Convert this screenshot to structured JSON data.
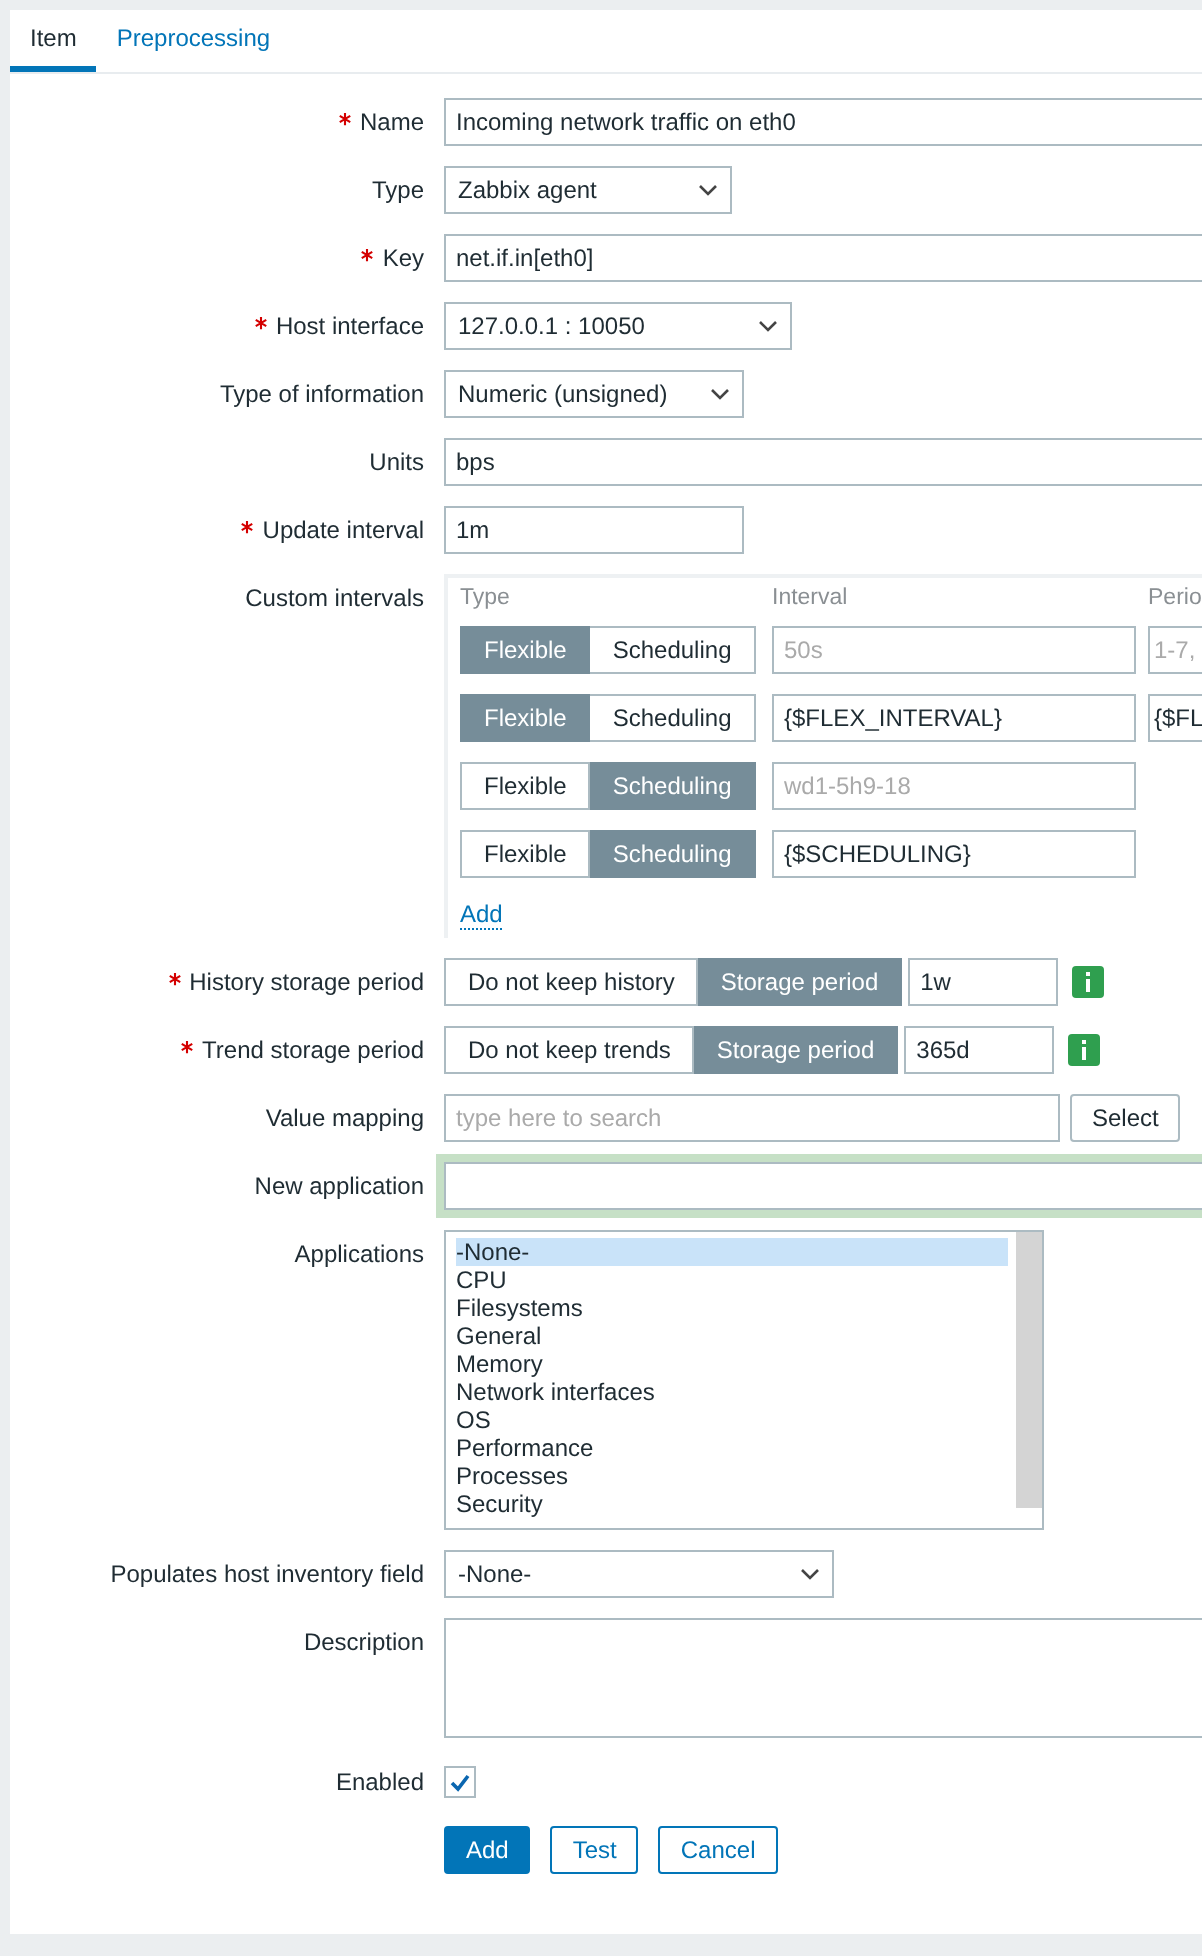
{
  "tabs": [
    {
      "label": "Item",
      "selected": true
    },
    {
      "label": "Preprocessing",
      "selected": false
    }
  ],
  "rows": [
    {
      "kind": "text",
      "label": "Name",
      "required": true,
      "value": "Incoming network traffic on eth0"
    },
    {
      "kind": "select",
      "label": "Type",
      "required": false,
      "value": "Zabbix agent"
    },
    {
      "kind": "text",
      "label": "Key",
      "required": true,
      "value": "net.if.in[eth0]"
    },
    {
      "kind": "select",
      "label": "Host interface",
      "required": true,
      "value": "127.0.0.1 : 10050"
    },
    {
      "kind": "select",
      "label": "Type of information",
      "required": false,
      "value": "Numeric (unsigned)"
    },
    {
      "kind": "text",
      "label": "Units",
      "required": false,
      "value": "bps"
    },
    {
      "kind": "text",
      "label": "Update interval",
      "required": true,
      "value": "1m"
    },
    {
      "kind": "intervals",
      "label": "Custom intervals",
      "required": false,
      "headers": [
        "Type",
        "Interval",
        "Perio"
      ],
      "add_link": "Add",
      "items": [
        {
          "options": [
            {
              "label": "Flexible",
              "selected": true
            },
            {
              "label": "Scheduling",
              "selected": false
            }
          ],
          "interval": {
            "placeholder": "50s"
          },
          "period": {
            "placeholder": "1-7,"
          }
        },
        {
          "options": [
            {
              "label": "Flexible",
              "selected": true
            },
            {
              "label": "Scheduling",
              "selected": false
            }
          ],
          "interval": {
            "value": "{$FLEX_INTERVAL}"
          },
          "period": {
            "value": "{$FL"
          }
        },
        {
          "options": [
            {
              "label": "Flexible",
              "selected": false
            },
            {
              "label": "Scheduling",
              "selected": true
            }
          ],
          "interval": {
            "placeholder": "wd1-5h9-18"
          }
        },
        {
          "options": [
            {
              "label": "Flexible",
              "selected": false
            },
            {
              "label": "Scheduling",
              "selected": true
            }
          ],
          "interval": {
            "value": "{$SCHEDULING}"
          }
        }
      ]
    },
    {
      "kind": "storage",
      "label": "History storage period",
      "required": true,
      "options": [
        {
          "label": "Do not keep history",
          "selected": false
        },
        {
          "label": "Storage period",
          "selected": true
        }
      ],
      "value": "1w"
    },
    {
      "kind": "storage",
      "label": "Trend storage period",
      "required": true,
      "options": [
        {
          "label": "Do not keep trends",
          "selected": false
        },
        {
          "label": "Storage period",
          "selected": true
        }
      ],
      "value": "365d"
    },
    {
      "kind": "search",
      "label": "Value mapping",
      "required": false,
      "placeholder": "type here to search",
      "button": "Select"
    },
    {
      "kind": "text",
      "label": "New application",
      "required": false,
      "focused": true
    },
    {
      "kind": "listbox",
      "label": "Applications",
      "required": false,
      "items": [
        {
          "label": "-None-",
          "selected": true
        },
        {
          "label": "CPU",
          "selected": false
        },
        {
          "label": "Filesystems",
          "selected": false
        },
        {
          "label": "General",
          "selected": false
        },
        {
          "label": "Memory",
          "selected": false
        },
        {
          "label": "Network interfaces",
          "selected": false
        },
        {
          "label": "OS",
          "selected": false
        },
        {
          "label": "Performance",
          "selected": false
        },
        {
          "label": "Processes",
          "selected": false
        },
        {
          "label": "Security",
          "selected": false
        }
      ]
    },
    {
      "kind": "select",
      "label": "Populates host inventory field",
      "required": false,
      "value": "-None-"
    },
    {
      "kind": "textarea",
      "label": "Description",
      "required": false
    },
    {
      "kind": "checkbox",
      "label": "Enabled",
      "required": false,
      "checked": true
    }
  ],
  "buttons": [
    {
      "label": "Add",
      "kind": "primary"
    },
    {
      "label": "Test",
      "kind": "secondary"
    },
    {
      "label": "Cancel",
      "kind": "secondary"
    }
  ]
}
